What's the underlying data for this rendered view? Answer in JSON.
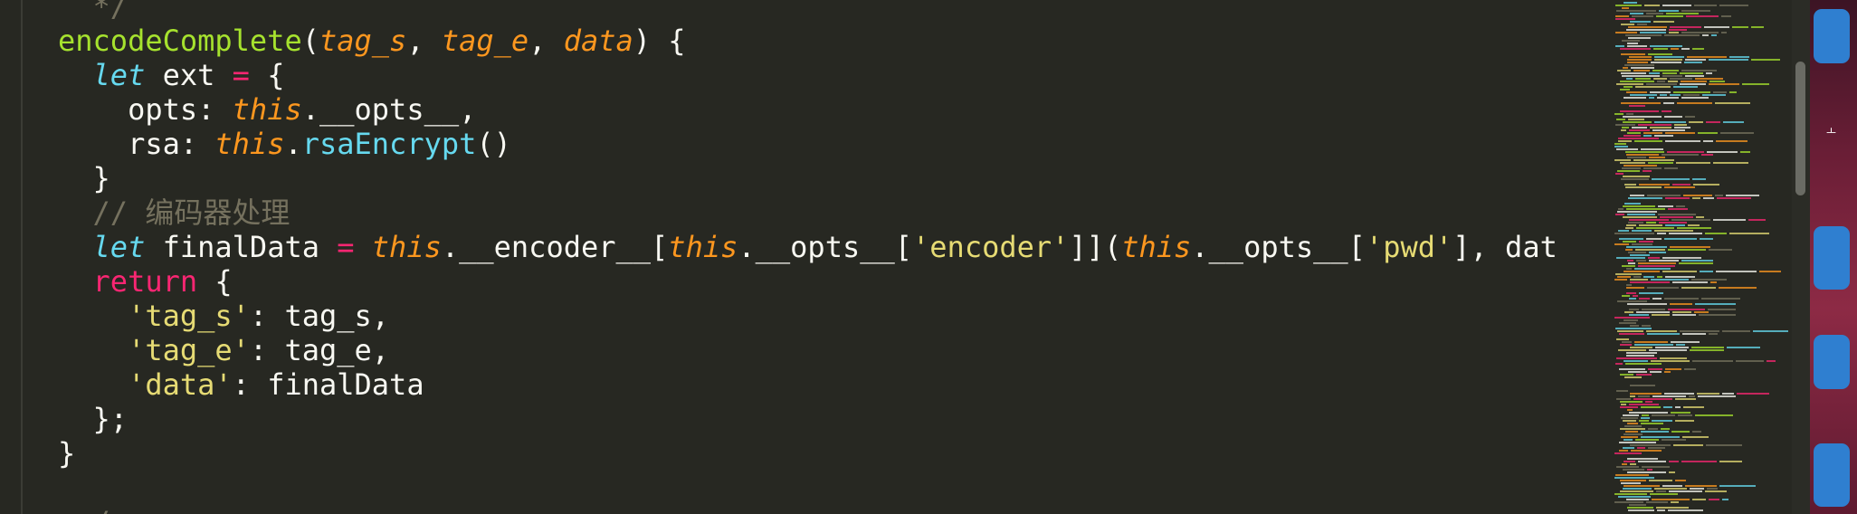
{
  "code": {
    "lines": [
      [
        {
          "t": "  */",
          "c": "comment"
        }
      ],
      [
        {
          "t": "encodeComplete",
          "c": "fn"
        },
        {
          "t": "(",
          "c": "plain"
        },
        {
          "t": "tag_s",
          "c": "param"
        },
        {
          "t": ", ",
          "c": "plain"
        },
        {
          "t": "tag_e",
          "c": "param"
        },
        {
          "t": ", ",
          "c": "plain"
        },
        {
          "t": "data",
          "c": "param"
        },
        {
          "t": ") {",
          "c": "plain"
        }
      ],
      [
        {
          "t": "  ",
          "c": "plain"
        },
        {
          "t": "let",
          "c": "kw"
        },
        {
          "t": " ext ",
          "c": "plain"
        },
        {
          "t": "=",
          "c": "op"
        },
        {
          "t": " {",
          "c": "plain"
        }
      ],
      [
        {
          "t": "    opts: ",
          "c": "plain"
        },
        {
          "t": "this",
          "c": "this"
        },
        {
          "t": ".__opts__,",
          "c": "plain"
        }
      ],
      [
        {
          "t": "    rsa: ",
          "c": "plain"
        },
        {
          "t": "this",
          "c": "this"
        },
        {
          "t": ".",
          "c": "plain"
        },
        {
          "t": "rsaEncrypt",
          "c": "call"
        },
        {
          "t": "()",
          "c": "plain"
        }
      ],
      [
        {
          "t": "  }",
          "c": "plain"
        }
      ],
      [
        {
          "t": "  // 编码器处理",
          "c": "comment"
        }
      ],
      [
        {
          "t": "  ",
          "c": "plain"
        },
        {
          "t": "let",
          "c": "kw"
        },
        {
          "t": " finalData ",
          "c": "plain"
        },
        {
          "t": "=",
          "c": "op"
        },
        {
          "t": " ",
          "c": "plain"
        },
        {
          "t": "this",
          "c": "this"
        },
        {
          "t": ".__encoder__[",
          "c": "plain"
        },
        {
          "t": "this",
          "c": "this"
        },
        {
          "t": ".__opts__[",
          "c": "plain"
        },
        {
          "t": "'encoder'",
          "c": "str"
        },
        {
          "t": "]](",
          "c": "plain"
        },
        {
          "t": "this",
          "c": "this"
        },
        {
          "t": ".__opts__[",
          "c": "plain"
        },
        {
          "t": "'pwd'",
          "c": "str"
        },
        {
          "t": "], dat",
          "c": "plain"
        }
      ],
      [
        {
          "t": "  ",
          "c": "plain"
        },
        {
          "t": "return",
          "c": "ret"
        },
        {
          "t": " {",
          "c": "plain"
        }
      ],
      [
        {
          "t": "    ",
          "c": "plain"
        },
        {
          "t": "'tag_s'",
          "c": "str"
        },
        {
          "t": ": tag_s,",
          "c": "plain"
        }
      ],
      [
        {
          "t": "    ",
          "c": "plain"
        },
        {
          "t": "'tag_e'",
          "c": "str"
        },
        {
          "t": ": tag_e,",
          "c": "plain"
        }
      ],
      [
        {
          "t": "    ",
          "c": "plain"
        },
        {
          "t": "'data'",
          "c": "str"
        },
        {
          "t": ": finalData",
          "c": "plain"
        }
      ],
      [
        {
          "t": "  };",
          "c": "plain"
        }
      ],
      [
        {
          "t": "}",
          "c": "plain"
        }
      ],
      [
        {
          "t": "",
          "c": "plain"
        }
      ],
      [
        {
          "t": "  /",
          "c": "comment"
        }
      ]
    ]
  },
  "colors": {
    "background": "#272822",
    "plain": "#f8f8f2",
    "function": "#a6e22e",
    "keyword": "#66d9ef",
    "param": "#fd971f",
    "operator": "#f92672",
    "string": "#e6db74",
    "comment": "#75715e"
  },
  "desktop": {
    "dock_label": "ㅗ"
  }
}
